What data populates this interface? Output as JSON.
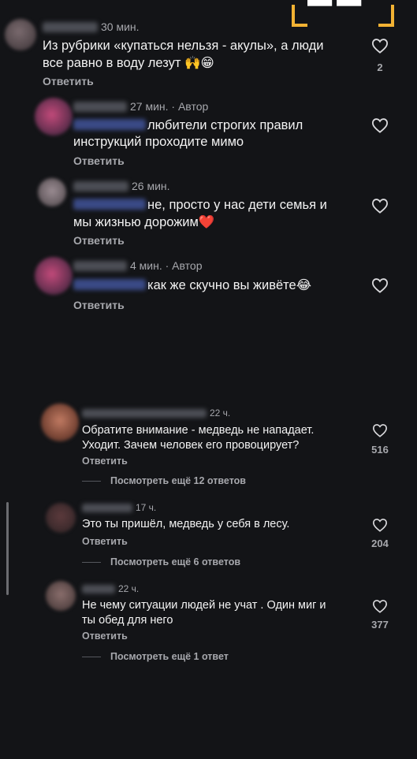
{
  "comments_top": [
    {
      "time": "30 мин.",
      "author_tag": "",
      "mention": false,
      "text": "Из рубрики «купаться нельзя - акулы», а люди все равно в воду лезут 🙌😁",
      "text_line1": "Из рубрики «купаться нельзя - акулы», а люди",
      "text_line2": "все равно в воду лезут",
      "emoji": "🙌😁",
      "reply": "Ответить",
      "likes": "2"
    },
    {
      "time": "27 мин. · Автор",
      "mention": true,
      "text_line1": "любители строгих правил",
      "text_line2": "инструкций проходите мимо",
      "reply": "Ответить"
    },
    {
      "time": "26 мин.",
      "mention": true,
      "text_line1": "не, просто у нас дети семья  и",
      "text_line2": "мы жизнью дорожим",
      "emoji": "❤️",
      "reply": "Ответить"
    },
    {
      "time": "4 мин. · Автор",
      "mention": true,
      "text_line1": "как же скучно вы живёте",
      "emoji": "😂",
      "reply": "Ответить"
    }
  ],
  "comments_bottom": [
    {
      "time": "22 ч.",
      "text_line1": "Обратите внимание - медведь не нападает.",
      "text_line2": "Уходит. Зачем человек его провоцирует?",
      "reply": "Ответить",
      "likes": "516",
      "more_replies": "Посмотреть ещё 12 ответов"
    },
    {
      "time": "17 ч.",
      "text_line1": "Это ты пришёл, медведь у себя в лесу.",
      "reply": "Ответить",
      "likes": "204",
      "more_replies": "Посмотреть ещё 6 ответов"
    },
    {
      "time": "22 ч.",
      "text_line1": "Не чему ситуации людей не учат . Один миг и",
      "text_line2": "ты обед для него",
      "reply": "Ответить",
      "likes": "377",
      "more_replies": "Посмотреть ещё 1 ответ"
    }
  ],
  "icons": {
    "like": "heart-outline-icon"
  },
  "colors": {
    "background": "#131417",
    "text": "#f3f3f3",
    "secondary": "#a7a8ad",
    "accent_corner": "#f2b233",
    "mention": "#3a4a86"
  }
}
